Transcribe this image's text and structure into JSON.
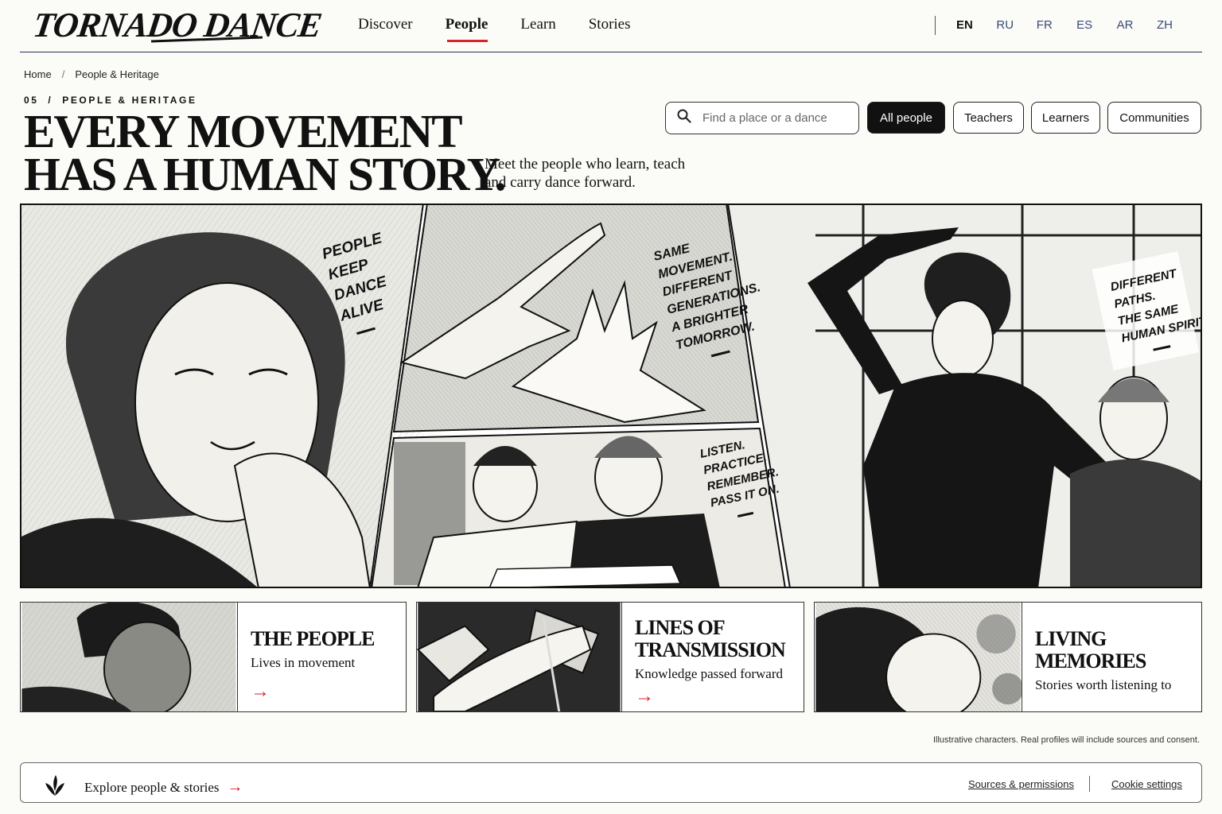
{
  "brand": {
    "logo_text": "TORNADO DANCE"
  },
  "nav": {
    "items": [
      {
        "label": "Discover",
        "active": false
      },
      {
        "label": "People",
        "active": true
      },
      {
        "label": "Learn",
        "active": false
      },
      {
        "label": "Stories",
        "active": false
      }
    ]
  },
  "languages": {
    "items": [
      "EN",
      "RU",
      "FR",
      "ES",
      "AR",
      "ZH"
    ],
    "active": "EN"
  },
  "breadcrumb": {
    "home": "Home",
    "separator": "/",
    "current": "People & Heritage"
  },
  "hero": {
    "eyebrow": "05  /  PEOPLE & HERITAGE",
    "headline_line1": "EVERY MOVEMENT",
    "headline_line2": "HAS A HUMAN STORY.",
    "subhead": "Meet the people who learn, teach and carry dance forward."
  },
  "search": {
    "placeholder": "Find a place or a dance",
    "value": ""
  },
  "filters": [
    {
      "label": "All people",
      "active": true
    },
    {
      "label": "Teachers",
      "active": false
    },
    {
      "label": "Learners",
      "active": false
    },
    {
      "label": "Communities",
      "active": false
    }
  ],
  "comic": {
    "caption1": [
      "PEOPLE",
      "KEEP",
      "DANCE",
      "ALIVE"
    ],
    "caption2": [
      "SAME",
      "MOVEMENT.",
      "DIFFERENT",
      "GENERATIONS.",
      "A BRIGHTER",
      "TOMORROW."
    ],
    "caption3": [
      "LISTEN.",
      "PRACTICE.",
      "REMEMBER.",
      "PASS IT ON."
    ],
    "caption4": [
      "DIFFERENT",
      "PATHS.",
      "THE SAME",
      "HUMAN SPIRIT."
    ]
  },
  "cards": [
    {
      "title": "THE PEOPLE",
      "subtitle": "Lives in movement",
      "arrow": "→"
    },
    {
      "title_line1": "LINES OF",
      "title_line2": "TRANSMISSION",
      "subtitle": "Knowledge passed forward",
      "arrow": "→"
    },
    {
      "title": "LIVING MEMORIES",
      "subtitle": "Stories worth listening to",
      "arrow": "→"
    }
  ],
  "disclaimer": "Illustrative characters. Real profiles will include sources and consent.",
  "footer": {
    "explore_label": "Explore people & stories",
    "explore_arrow": "→",
    "links": [
      "Sources & permissions",
      "Cookie settings"
    ]
  },
  "colors": {
    "accent": "#d8232a",
    "ink": "#111111",
    "paper": "#fbfbf7",
    "nav_lang": "#3a4a7a"
  }
}
